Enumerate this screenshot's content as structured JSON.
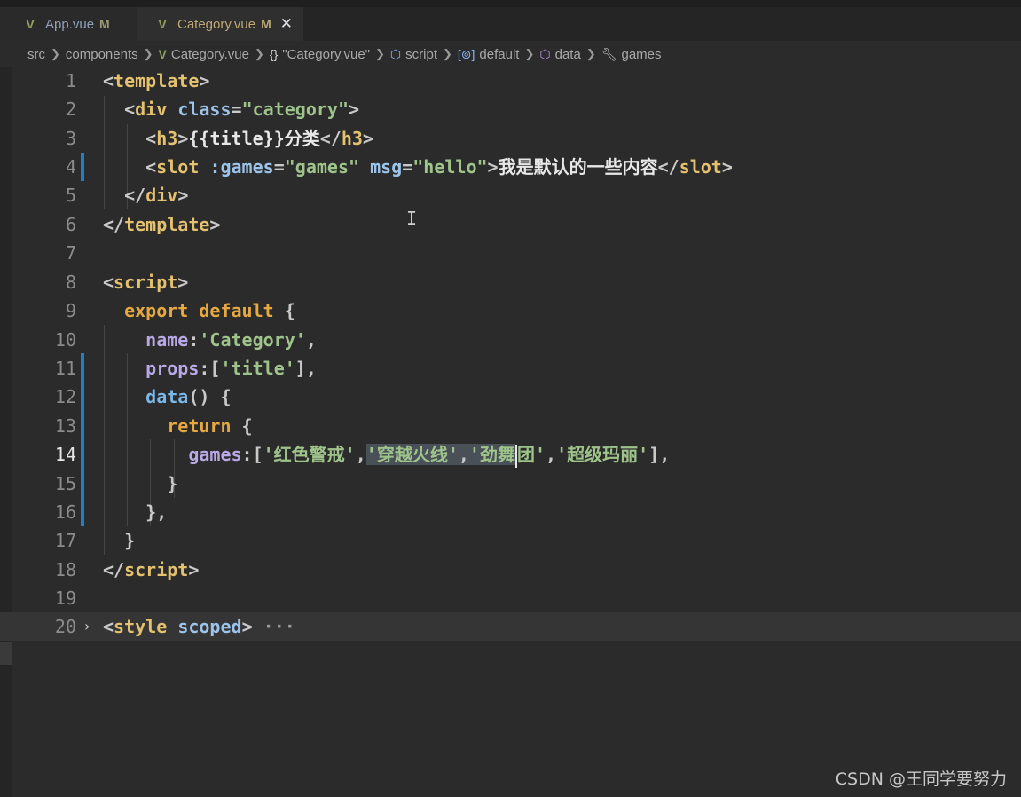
{
  "tabs": [
    {
      "label": "App.vue",
      "modified": "M",
      "icon": "vue-icon"
    },
    {
      "label": "Category.vue",
      "modified": "M",
      "icon": "vue-icon",
      "close": "✕"
    }
  ],
  "breadcrumb": {
    "items": [
      "src",
      "components",
      "Category.vue",
      "\"Category.vue\"",
      "script",
      "default",
      "data",
      "games"
    ],
    "icons": [
      "braces-icon",
      "cube-icon",
      "variable-icon",
      "cube-icon",
      "wrench-icon"
    ]
  },
  "editor": {
    "line_numbers": [
      "1",
      "2",
      "3",
      "4",
      "5",
      "6",
      "7",
      "8",
      "9",
      "10",
      "11",
      "12",
      "13",
      "14",
      "15",
      "16",
      "17",
      "18",
      "19",
      "20"
    ],
    "current_line": "14",
    "lines": {
      "l1": {
        "open": "<",
        "tag": "template",
        "close": ">"
      },
      "l2": {
        "open": "<",
        "tag": "div",
        "attr": "class",
        "eq": "=",
        "str": "\"category\"",
        "close": ">"
      },
      "l3": {
        "open": "<",
        "tag": "h3",
        "close": ">",
        "mustache": "{{title}}",
        "text": "分类",
        "end_open": "</",
        "end_tag": "h3",
        "end_close": ">"
      },
      "l4": {
        "open": "<",
        "tag": "slot",
        "attr1": ":games",
        "eq": "=",
        "str1": "\"games\"",
        "attr2": "msg",
        "str2": "\"hello\"",
        "close": ">",
        "text": "我是默认的一些内容",
        "end_open": "</",
        "end_tag": "slot",
        "end_close": ">"
      },
      "l5": {
        "open": "</",
        "tag": "div",
        "close": ">"
      },
      "l6": {
        "open": "</",
        "tag": "template",
        "close": ">"
      },
      "l8": {
        "open": "<",
        "tag": "script",
        "close": ">"
      },
      "l9": {
        "kw1": "export",
        "kw2": "default",
        "brace": "{"
      },
      "l10": {
        "prop": "name",
        "colon": ":",
        "str": "'Category'",
        "comma": ","
      },
      "l11": {
        "prop": "props",
        "colon": ":[",
        "str": "'title'",
        "end": "],"
      },
      "l12": {
        "fn": "data",
        "paren": "() {"
      },
      "l13": {
        "kw": "return",
        "brace": "{"
      },
      "l14": {
        "prop": "games",
        "colon": ":[",
        "s1": "'红色警戒'",
        "c1": ",",
        "s2": "'穿越火线'",
        "c2": ",",
        "s3a": "'劲舞",
        "s3b": "团'",
        "c3": ",",
        "s4": "'超级玛丽'",
        "end": "],"
      },
      "l15": {
        "brace": "}"
      },
      "l16": {
        "brace": "},"
      },
      "l17": {
        "brace": "}"
      },
      "l18": {
        "open": "</",
        "tag": "script",
        "close": ">"
      },
      "l20": {
        "open": "<",
        "tag": "style",
        "attr": "scoped",
        "close": ">",
        "ellipsis": "···",
        "fold": "›"
      }
    }
  },
  "watermark": "CSDN @王同学要努力",
  "colors": {
    "background": "#2b2b2b",
    "tag": "#e3c16f",
    "attribute": "#9cc3ea",
    "string": "#9ec48b",
    "keyword": "#e6a840",
    "property": "#b9a8e6",
    "modified_bar": "#1f7fc8"
  }
}
